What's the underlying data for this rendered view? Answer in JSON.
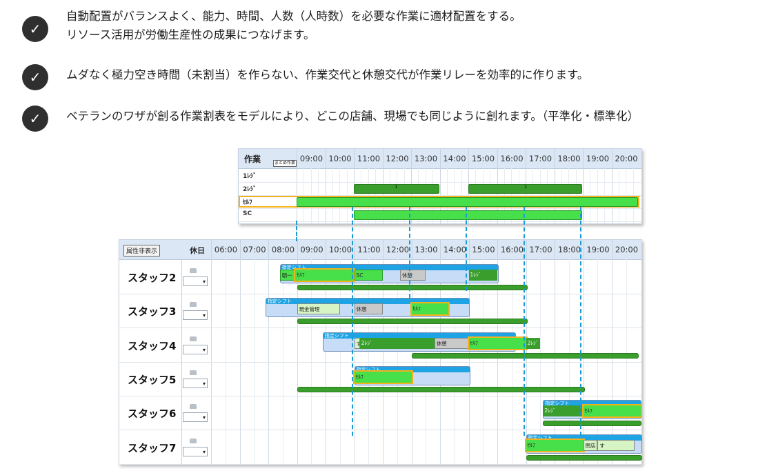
{
  "bullets": [
    {
      "line1": "自動配置がバランスよく、能力、時間、人数（人時数）を必要な作業に適材配置をする。",
      "line2": "リソース活用が労働生産性の成果につなげます。"
    },
    {
      "line1": "ムダなく極力空き時間（未割当）を作らない、作業交代と休憩交代が作業リレーを効率的に作ります。"
    },
    {
      "line1": "ベテランのワザが創る作業割表をモデルにより、どこの店舗、現場でも同じように創れます。（平準化・標準化）"
    }
  ],
  "top_panel": {
    "header_label": "作業",
    "group_button": "まとめ作業",
    "times": [
      "09:00",
      "10:00",
      "11:00",
      "12:00",
      "13:00",
      "14:00",
      "15:00",
      "16:00",
      "17:00",
      "18:00",
      "19:00",
      "20:00"
    ],
    "rows": [
      {
        "label": "1ﾚｼﾞ"
      },
      {
        "label": "2ﾚｼﾞ",
        "bar_text_1": "1",
        "bar_text_2": "1"
      },
      {
        "label": "ｾﾙﾌ"
      },
      {
        "label": "SC"
      }
    ]
  },
  "bottom_panel": {
    "attr_button": "属性非表示",
    "holiday_label": "休日",
    "times": [
      "06:00",
      "07:00",
      "08:00",
      "09:00",
      "10:00",
      "11:00",
      "12:00",
      "13:00",
      "14:00",
      "15:00",
      "16:00",
      "17:00",
      "18:00",
      "19:00",
      "20:00"
    ],
    "shift_label": "指定シフト",
    "staff": [
      {
        "name": "スタッフ2",
        "tasks": [
          "朝一",
          "ｾﾙﾌ",
          "SC",
          "休憩",
          "1ﾚｼﾞ"
        ]
      },
      {
        "name": "スタッフ3",
        "tasks": [
          "現金管理",
          "休憩",
          "ｾﾙﾌ"
        ]
      },
      {
        "name": "スタッフ4",
        "tasks": [
          "す",
          "2ﾚｼﾞ",
          "休憩",
          "ｾﾙﾌ",
          "2ﾚｼﾞ"
        ]
      },
      {
        "name": "スタッフ5",
        "tasks": [
          "ｾﾙﾌ"
        ]
      },
      {
        "name": "スタッフ6",
        "tasks": [
          "2ﾚｼﾞ",
          "ｾﾙﾌ"
        ]
      },
      {
        "name": "スタッフ7",
        "tasks": [
          "ｾﾙﾌ",
          "閉店",
          "す",
          "精算"
        ]
      }
    ]
  },
  "colors": {
    "highlight": "#f2b21b",
    "dash": "#1b9bd6",
    "self": "#48e04a",
    "register": "#3a9e2c",
    "shift": "#1ea4e4"
  },
  "icons": {
    "check": "check-icon",
    "lock": "lock-icon",
    "dropdown": "chevron-down-icon"
  }
}
